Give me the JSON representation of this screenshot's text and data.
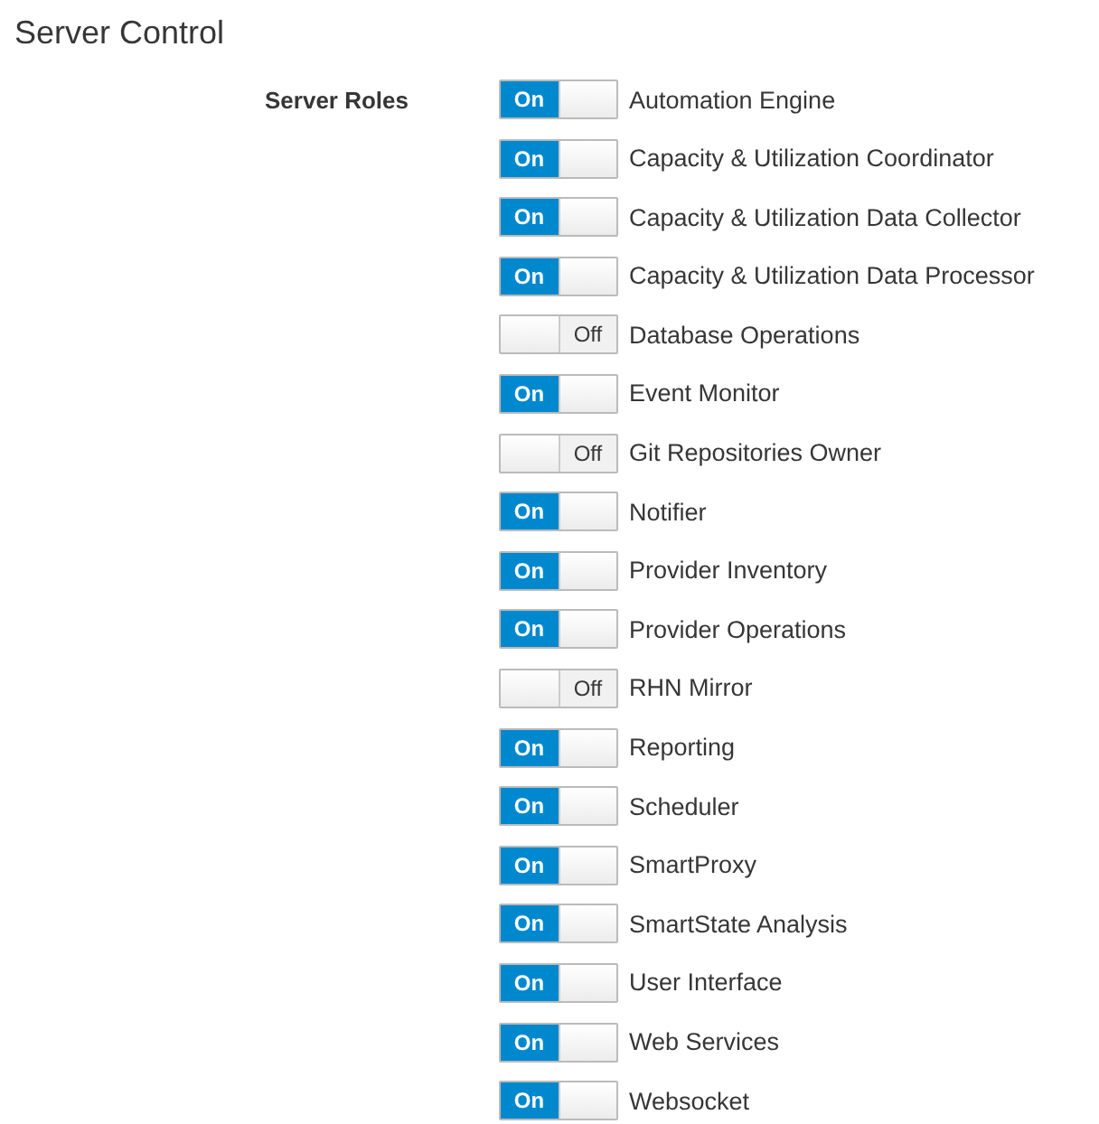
{
  "title": "Server Control",
  "roles_label": "Server Roles",
  "roles": [
    {
      "name": "Automation Engine",
      "on": true,
      "switch_text": "On"
    },
    {
      "name": "Capacity & Utilization Coordinator",
      "on": true,
      "switch_text": "On"
    },
    {
      "name": "Capacity & Utilization Data Collector",
      "on": true,
      "switch_text": "On"
    },
    {
      "name": "Capacity & Utilization Data Processor",
      "on": true,
      "switch_text": "On"
    },
    {
      "name": "Database Operations",
      "on": false,
      "switch_text": "Off"
    },
    {
      "name": "Event Monitor",
      "on": true,
      "switch_text": "On"
    },
    {
      "name": "Git Repositories Owner",
      "on": false,
      "switch_text": "Off"
    },
    {
      "name": "Notifier",
      "on": true,
      "switch_text": "On"
    },
    {
      "name": "Provider Inventory",
      "on": true,
      "switch_text": "On"
    },
    {
      "name": "Provider Operations",
      "on": true,
      "switch_text": "On"
    },
    {
      "name": "RHN Mirror",
      "on": false,
      "switch_text": "Off"
    },
    {
      "name": "Reporting",
      "on": true,
      "switch_text": "On"
    },
    {
      "name": "Scheduler",
      "on": true,
      "switch_text": "On"
    },
    {
      "name": "SmartProxy",
      "on": true,
      "switch_text": "On"
    },
    {
      "name": "SmartState Analysis",
      "on": true,
      "switch_text": "On"
    },
    {
      "name": "User Interface",
      "on": true,
      "switch_text": "On"
    },
    {
      "name": "Web Services",
      "on": true,
      "switch_text": "On"
    },
    {
      "name": "Websocket",
      "on": true,
      "switch_text": "On"
    }
  ]
}
